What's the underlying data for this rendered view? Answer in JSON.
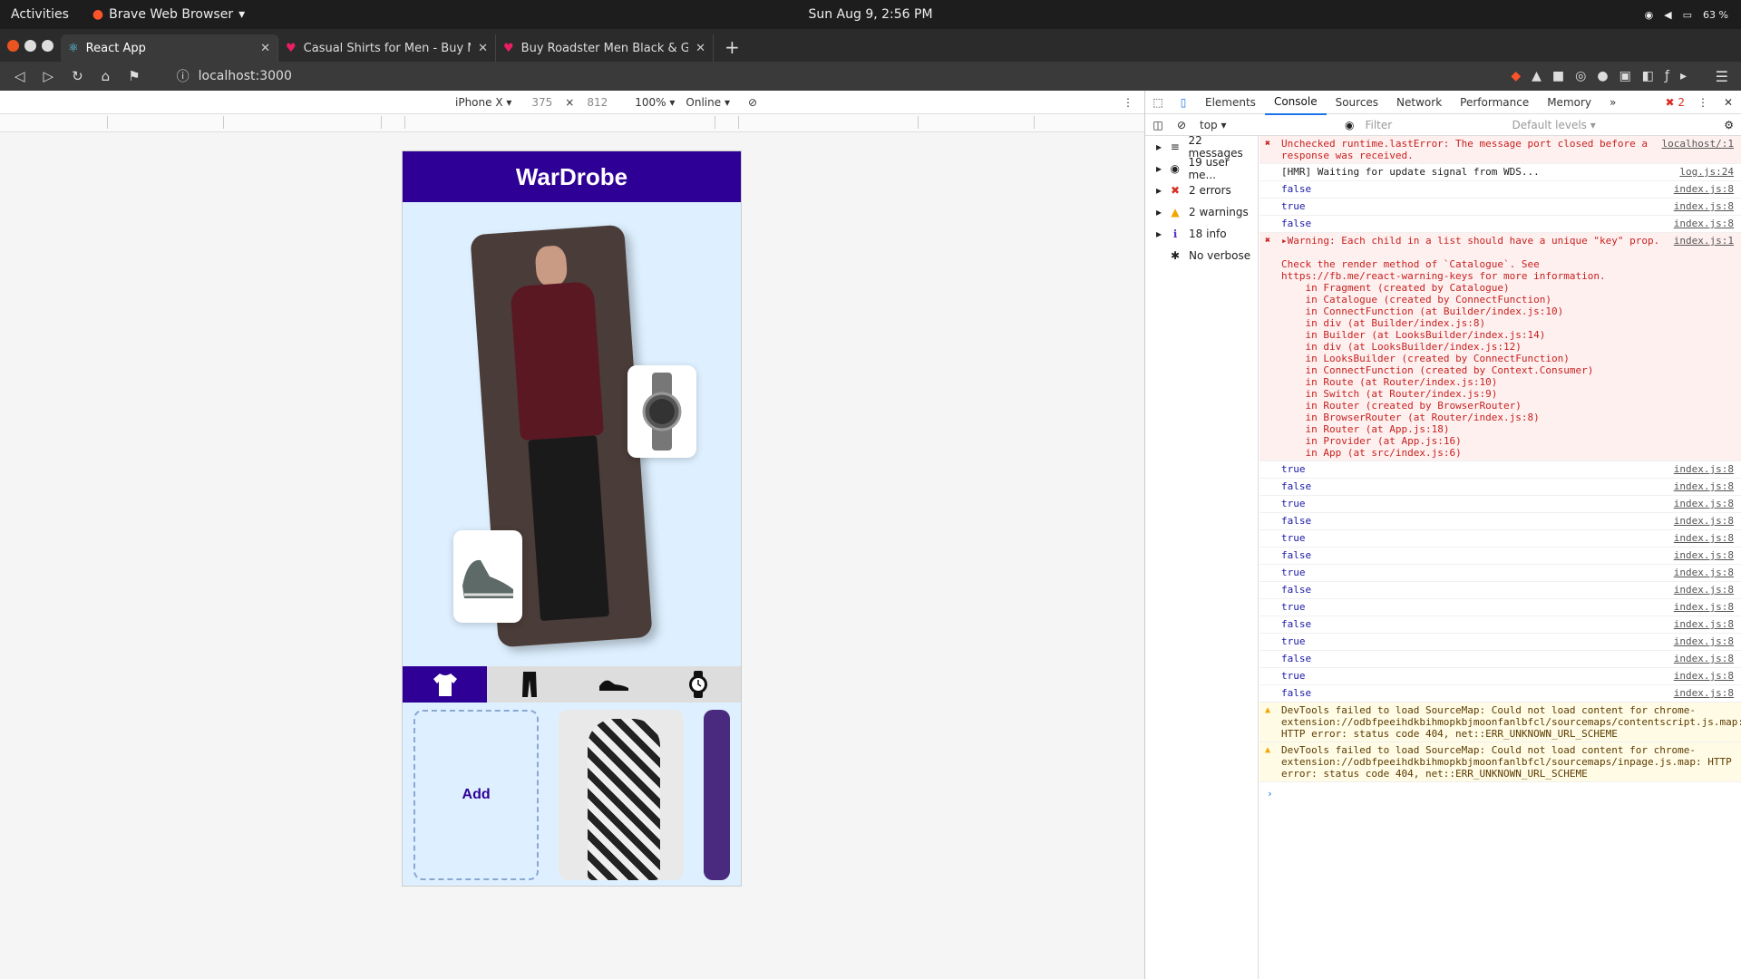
{
  "os_bar": {
    "activities": "Activities",
    "app": "Brave Web Browser",
    "clock": "Sun Aug  9,  2:56 PM",
    "battery": "63 %"
  },
  "tabs": [
    {
      "label": "React App"
    },
    {
      "label": "Casual Shirts for Men - Buy Men"
    },
    {
      "label": "Buy Roadster Men Black & Grey"
    }
  ],
  "address": {
    "url": "localhost:3000"
  },
  "device_toolbar": {
    "device": "iPhone X",
    "width": "375",
    "times": "×",
    "height": "812",
    "zoom": "100%",
    "network": "Online"
  },
  "app": {
    "title": "WarDrobe",
    "add_label": "Add",
    "colors": {
      "brand": "#2e0096",
      "background": "#def0ff"
    }
  },
  "devtools": {
    "tabs": [
      "Elements",
      "Console",
      "Sources",
      "Network",
      "Performance",
      "Memory"
    ],
    "active_tab": "Console",
    "more": "»",
    "error_count": "2",
    "context": "top",
    "filter_placeholder": "Filter",
    "levels": "Default levels",
    "sidebar": [
      {
        "label": "22 messages"
      },
      {
        "label": "19 user me..."
      },
      {
        "label": "2 errors"
      },
      {
        "label": "2 warnings"
      },
      {
        "label": "18 info"
      },
      {
        "label": "No verbose"
      }
    ],
    "messages": [
      {
        "text": "Unchecked runtime.lastError: The message port closed before a response was received.",
        "src": "localhost/:1"
      },
      {
        "text": "[HMR] Waiting for update signal from WDS...",
        "src": "log.js:24"
      },
      {
        "text": "false",
        "src": "index.js:8"
      },
      {
        "text": "true",
        "src": "index.js:8"
      },
      {
        "text": "false",
        "src": "index.js:8"
      },
      {
        "text": "▸Warning: Each child in a list should have a unique \"key\" prop.\n\nCheck the render method of `Catalogue`. See https://fb.me/react-warning-keys for more information.\n    in Fragment (created by Catalogue)\n    in Catalogue (created by ConnectFunction)\n    in ConnectFunction (at Builder/index.js:10)\n    in div (at Builder/index.js:8)\n    in Builder (at LooksBuilder/index.js:14)\n    in div (at LooksBuilder/index.js:12)\n    in LooksBuilder (created by ConnectFunction)\n    in ConnectFunction (created by Context.Consumer)\n    in Route (at Router/index.js:10)\n    in Switch (at Router/index.js:9)\n    in Router (created by BrowserRouter)\n    in BrowserRouter (at Router/index.js:8)\n    in Router (at App.js:18)\n    in Provider (at App.js:16)\n    in App (at src/index.js:6)",
        "src": "index.js:1"
      },
      {
        "text": "true",
        "src": "index.js:8"
      },
      {
        "text": "false",
        "src": "index.js:8"
      },
      {
        "text": "true",
        "src": "index.js:8"
      },
      {
        "text": "false",
        "src": "index.js:8"
      },
      {
        "text": "true",
        "src": "index.js:8"
      },
      {
        "text": "false",
        "src": "index.js:8"
      },
      {
        "text": "true",
        "src": "index.js:8"
      },
      {
        "text": "false",
        "src": "index.js:8"
      },
      {
        "text": "true",
        "src": "index.js:8"
      },
      {
        "text": "false",
        "src": "index.js:8"
      },
      {
        "text": "true",
        "src": "index.js:8"
      },
      {
        "text": "false",
        "src": "index.js:8"
      },
      {
        "text": "true",
        "src": "index.js:8"
      },
      {
        "text": "false",
        "src": "index.js:8"
      },
      {
        "text": "DevTools failed to load SourceMap: Could not load content for chrome-extension://odbfpeeihdkbihmopkbjmoonfanlbfcl/sourcemaps/contentscript.js.map: HTTP error: status code 404, net::ERR_UNKNOWN_URL_SCHEME",
        "src": ""
      },
      {
        "text": "DevTools failed to load SourceMap: Could not load content for chrome-extension://odbfpeeihdkbihmopkbjmoonfanlbfcl/sourcemaps/inpage.js.map: HTTP error: status code 404, net::ERR_UNKNOWN_URL_SCHEME",
        "src": ""
      }
    ],
    "prompt": "›"
  }
}
